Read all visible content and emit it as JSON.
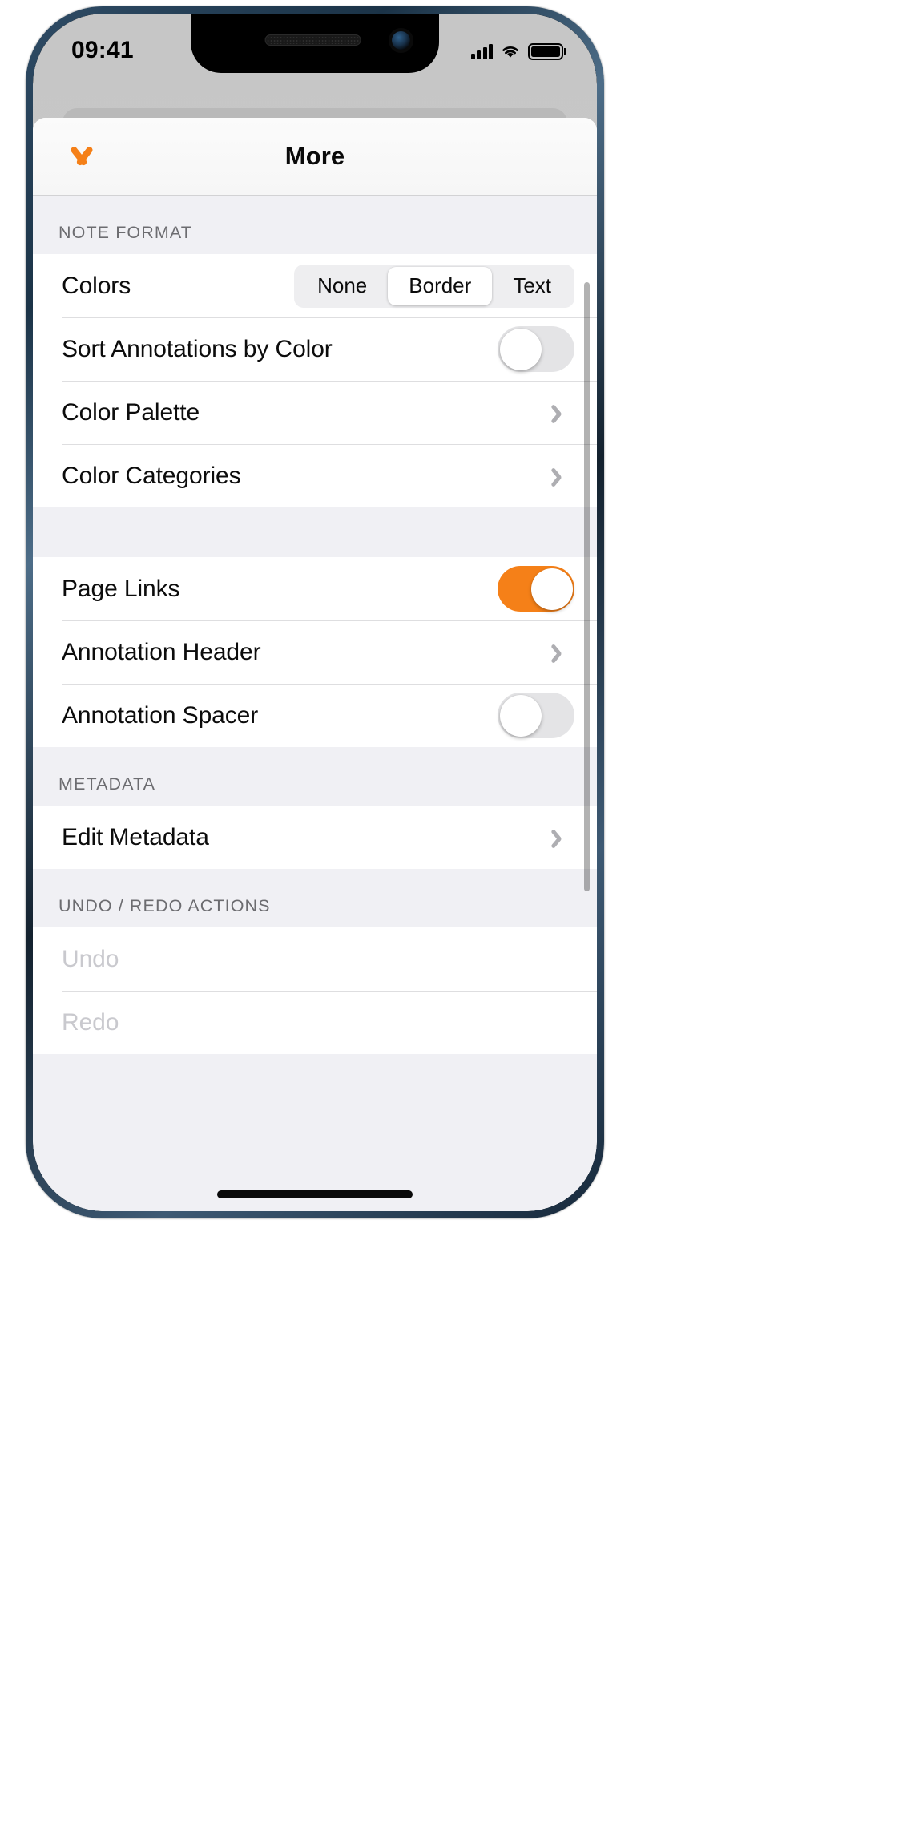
{
  "status_bar": {
    "time": "09:41",
    "signal_icon": "cellular-signal-icon",
    "wifi_icon": "wifi-icon",
    "battery_icon": "battery-full-icon"
  },
  "sheet": {
    "nav": {
      "dismiss_icon": "chevron-down-icon",
      "title": "More"
    }
  },
  "sections": [
    {
      "header": "NOTE FORMAT",
      "rows": [
        {
          "label": "Colors",
          "control": "segmented",
          "segments": [
            "None",
            "Border",
            "Text"
          ],
          "selected": "Border"
        },
        {
          "label": "Sort Annotations by Color",
          "control": "toggle",
          "value": "off"
        },
        {
          "label": "Color Palette",
          "control": "disclosure"
        },
        {
          "label": "Color Categories",
          "control": "disclosure"
        }
      ]
    },
    {
      "header": "",
      "rows": [
        {
          "label": "Page Links",
          "control": "toggle",
          "value": "on"
        },
        {
          "label": "Annotation Header",
          "control": "disclosure"
        },
        {
          "label": "Annotation Spacer",
          "control": "toggle",
          "value": "off"
        }
      ]
    },
    {
      "header": "METADATA",
      "rows": [
        {
          "label": "Edit Metadata",
          "control": "disclosure"
        }
      ]
    },
    {
      "header": "UNDO / REDO ACTIONS",
      "rows": [
        {
          "label": "Undo",
          "control": "none",
          "disabled": true
        },
        {
          "label": "Redo",
          "control": "none",
          "disabled": true
        }
      ]
    }
  ],
  "colors": {
    "accent": "#f58018",
    "toggle_on": "#f58018",
    "toggle_off": "#e4e4e6",
    "section_bg": "#f0f0f4",
    "row_bg": "#ffffff",
    "separator": "#dedee0",
    "disabled_text": "#c9c9ce",
    "header_text": "#6c6c70"
  }
}
